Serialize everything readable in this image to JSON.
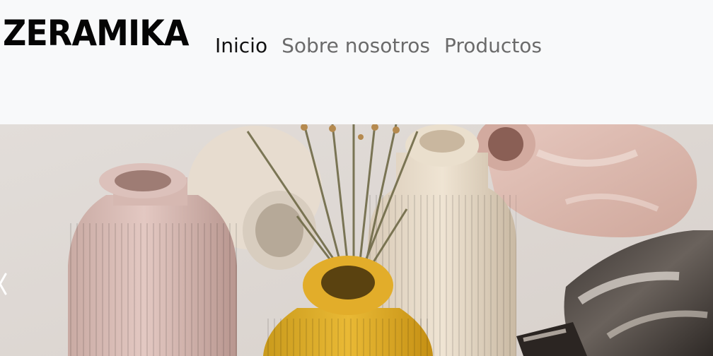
{
  "brand": {
    "name": "ZERAMIKA"
  },
  "nav": {
    "items": [
      {
        "label": "Inicio",
        "active": true
      },
      {
        "label": "Sobre nosotros",
        "active": false
      },
      {
        "label": "Productos",
        "active": false
      }
    ]
  },
  "hero": {
    "carousel_prev_icon": "chevron-left-icon"
  },
  "colors": {
    "navbar_bg": "#f8f9fa",
    "nav_active": "#111111",
    "nav_inactive": "#6b6b6b"
  }
}
